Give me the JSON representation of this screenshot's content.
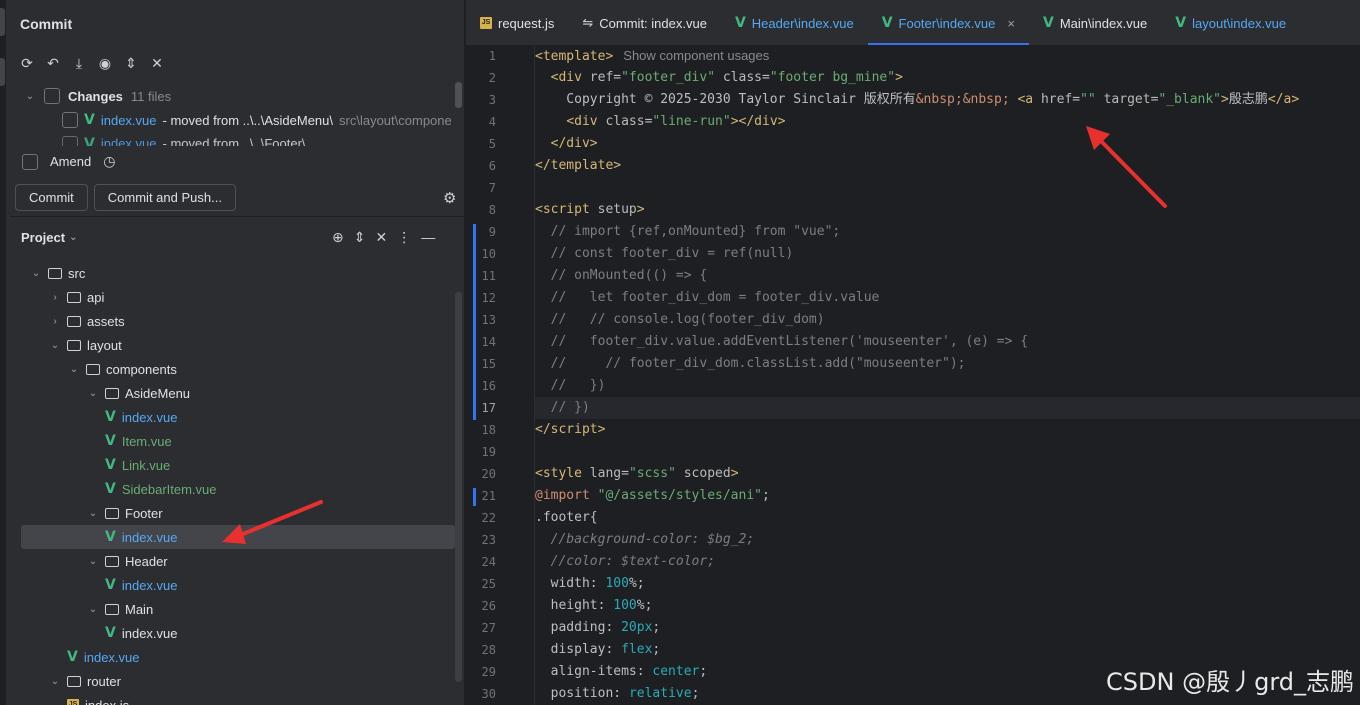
{
  "commit_panel": {
    "title": "Commit",
    "changes_label": "Changes",
    "changes_count": "11 files",
    "change_file_name": "index.vue",
    "change_file_desc": "- moved from ..\\..\\AsideMenu\\",
    "change_file_path": "src\\layout\\compone",
    "change_file2_name": "index.vue",
    "change_file2_desc": "- moved from ..\\..\\Footer\\",
    "amend_label": "Amend",
    "commit_button": "Commit",
    "commit_push_button": "Commit and Push..."
  },
  "project_panel": {
    "title": "Project",
    "tree": [
      {
        "label": "src",
        "type": "folder",
        "depth": 2,
        "expanded": true
      },
      {
        "label": "api",
        "type": "folder",
        "depth": 3,
        "expanded": false
      },
      {
        "label": "assets",
        "type": "folder",
        "depth": 3,
        "expanded": false
      },
      {
        "label": "layout",
        "type": "folder",
        "depth": 3,
        "expanded": true
      },
      {
        "label": "components",
        "type": "folder",
        "depth": 4,
        "expanded": true
      },
      {
        "label": "AsideMenu",
        "type": "folder",
        "depth": 5,
        "expanded": true
      },
      {
        "label": "index.vue",
        "type": "vue",
        "depth": 6,
        "color": "blue"
      },
      {
        "label": "Item.vue",
        "type": "vue",
        "depth": 6,
        "color": "green"
      },
      {
        "label": "Link.vue",
        "type": "vue",
        "depth": 6,
        "color": "green"
      },
      {
        "label": "SidebarItem.vue",
        "type": "vue",
        "depth": 6,
        "color": "green"
      },
      {
        "label": "Footer",
        "type": "folder",
        "depth": 5,
        "expanded": true
      },
      {
        "label": "index.vue",
        "type": "vue",
        "depth": 6,
        "color": "blue",
        "selected": true
      },
      {
        "label": "Header",
        "type": "folder",
        "depth": 5,
        "expanded": true
      },
      {
        "label": "index.vue",
        "type": "vue",
        "depth": 6,
        "color": "blue"
      },
      {
        "label": "Main",
        "type": "folder",
        "depth": 5,
        "expanded": true
      },
      {
        "label": "index.vue",
        "type": "vue",
        "depth": 6,
        "color": "plain"
      },
      {
        "label": "index.vue",
        "type": "vue",
        "depth": 4,
        "color": "blue"
      },
      {
        "label": "router",
        "type": "folder",
        "depth": 3,
        "expanded": true
      },
      {
        "label": "index.js",
        "type": "js",
        "depth": 4,
        "color": "plain"
      }
    ]
  },
  "tabs": [
    {
      "label": "request.js",
      "icon": "js",
      "active": false
    },
    {
      "label": "Commit: index.vue",
      "icon": "commit",
      "active": false
    },
    {
      "label": "Header\\index.vue",
      "icon": "vue",
      "active": false,
      "color": "blue"
    },
    {
      "label": "Footer\\index.vue",
      "icon": "vue",
      "active": true
    },
    {
      "label": "Main\\index.vue",
      "icon": "vue",
      "active": false
    },
    {
      "label": "layout\\index.vue",
      "icon": "vue",
      "active": false,
      "color": "blue"
    }
  ],
  "editor": {
    "current_line": 17,
    "hint_text": "Show component usages",
    "lines": [
      {
        "n": 1,
        "html": "<span class=\"tag\">&lt;template&gt;</span>",
        "hint": true
      },
      {
        "n": 2,
        "html": "  <span class=\"tag\">&lt;div</span> <span class=\"attr\">ref</span>=<span class=\"str\">\"footer_div\"</span> <span class=\"attr\">class</span>=<span class=\"str\">\"footer bg_mine\"</span><span class=\"tag\">&gt;</span>"
      },
      {
        "n": 3,
        "html": "    Copyright © 2025-2030 Taylor Sinclair 版权所有<span class=\"ent\">&amp;nbsp;&amp;nbsp;</span> <span class=\"tag\">&lt;a</span> <span class=\"attr\">href</span>=<span class=\"str\">\"\"</span> <span class=\"attr\">target</span>=<span class=\"str\">\"_blank\"</span><span class=\"tag\">&gt;</span>殷志鹏<span class=\"tag\">&lt;/a&gt;</span>"
      },
      {
        "n": 4,
        "html": "    <span class=\"tag\">&lt;div</span> <span class=\"attr\">class</span>=<span class=\"str\">\"line-run\"</span><span class=\"tag\">&gt;&lt;/div&gt;</span>"
      },
      {
        "n": 5,
        "html": "  <span class=\"tag\">&lt;/div&gt;</span>"
      },
      {
        "n": 6,
        "html": "<span class=\"tag\">&lt;/template&gt;</span>"
      },
      {
        "n": 7,
        "html": ""
      },
      {
        "n": 8,
        "html": "<span class=\"tag\">&lt;script</span> <span class=\"attr\">setup</span><span class=\"tag\">&gt;</span>"
      },
      {
        "n": 9,
        "html": "  <span class=\"cmt\">// import {ref,onMounted} from \"vue\";</span>"
      },
      {
        "n": 10,
        "html": "  <span class=\"cmt\">// const footer_div = ref(null)</span>"
      },
      {
        "n": 11,
        "html": "  <span class=\"cmt\">// onMounted(() =&gt; {</span>"
      },
      {
        "n": 12,
        "html": "  <span class=\"cmt\">//   let footer_div_dom = footer_div.value</span>"
      },
      {
        "n": 13,
        "html": "  <span class=\"cmt\">//   // console.log(footer_div_dom)</span>"
      },
      {
        "n": 14,
        "html": "  <span class=\"cmt\">//   footer_div.value.addEventListener('mouseenter', (e) =&gt; {</span>"
      },
      {
        "n": 15,
        "html": "  <span class=\"cmt\">//     // footer_div_dom.classList.add(\"mouseenter\");</span>"
      },
      {
        "n": 16,
        "html": "  <span class=\"cmt\">//   })</span>"
      },
      {
        "n": 17,
        "html": "  <span class=\"cmt\">// })</span>"
      },
      {
        "n": 18,
        "html": "<span class=\"tag\">&lt;/script&gt;</span>"
      },
      {
        "n": 19,
        "html": ""
      },
      {
        "n": 20,
        "html": "<span class=\"tag\">&lt;style</span> <span class=\"attr\">lang</span>=<span class=\"str\">\"scss\"</span> <span class=\"attr\">scoped</span><span class=\"tag\">&gt;</span>"
      },
      {
        "n": 21,
        "html": "<span class=\"kw\">@import</span> <span class=\"str\">\"@/assets/styles/ani\"</span>;"
      },
      {
        "n": 22,
        "html": "<span class=\"sel\">.footer</span>{"
      },
      {
        "n": 23,
        "html": "  <span class=\"cmti\">//background-color: $bg_2;</span>"
      },
      {
        "n": 24,
        "html": "  <span class=\"cmti\">//color: $text-color;</span>"
      },
      {
        "n": 25,
        "html": "  <span class=\"prop\">width</span>: <span class=\"num\">100</span>%;"
      },
      {
        "n": 26,
        "html": "  <span class=\"prop\">height</span>: <span class=\"num\">100</span>%;"
      },
      {
        "n": 27,
        "html": "  <span class=\"prop\">padding</span>: <span class=\"num\">20px</span>;"
      },
      {
        "n": 28,
        "html": "  <span class=\"prop\">display</span>: <span class=\"num\">flex</span>;"
      },
      {
        "n": 29,
        "html": "  <span class=\"prop\">align-items</span>: <span class=\"num\">center</span>;"
      },
      {
        "n": 30,
        "html": "  <span class=\"prop\">position</span>: <span class=\"num\">relative</span>;"
      }
    ]
  },
  "watermark": "CSDN @殷丿grd_志鹏",
  "colors": {
    "accent": "#3574f0",
    "arrow": "#e8312f",
    "vue": "#41b883"
  }
}
